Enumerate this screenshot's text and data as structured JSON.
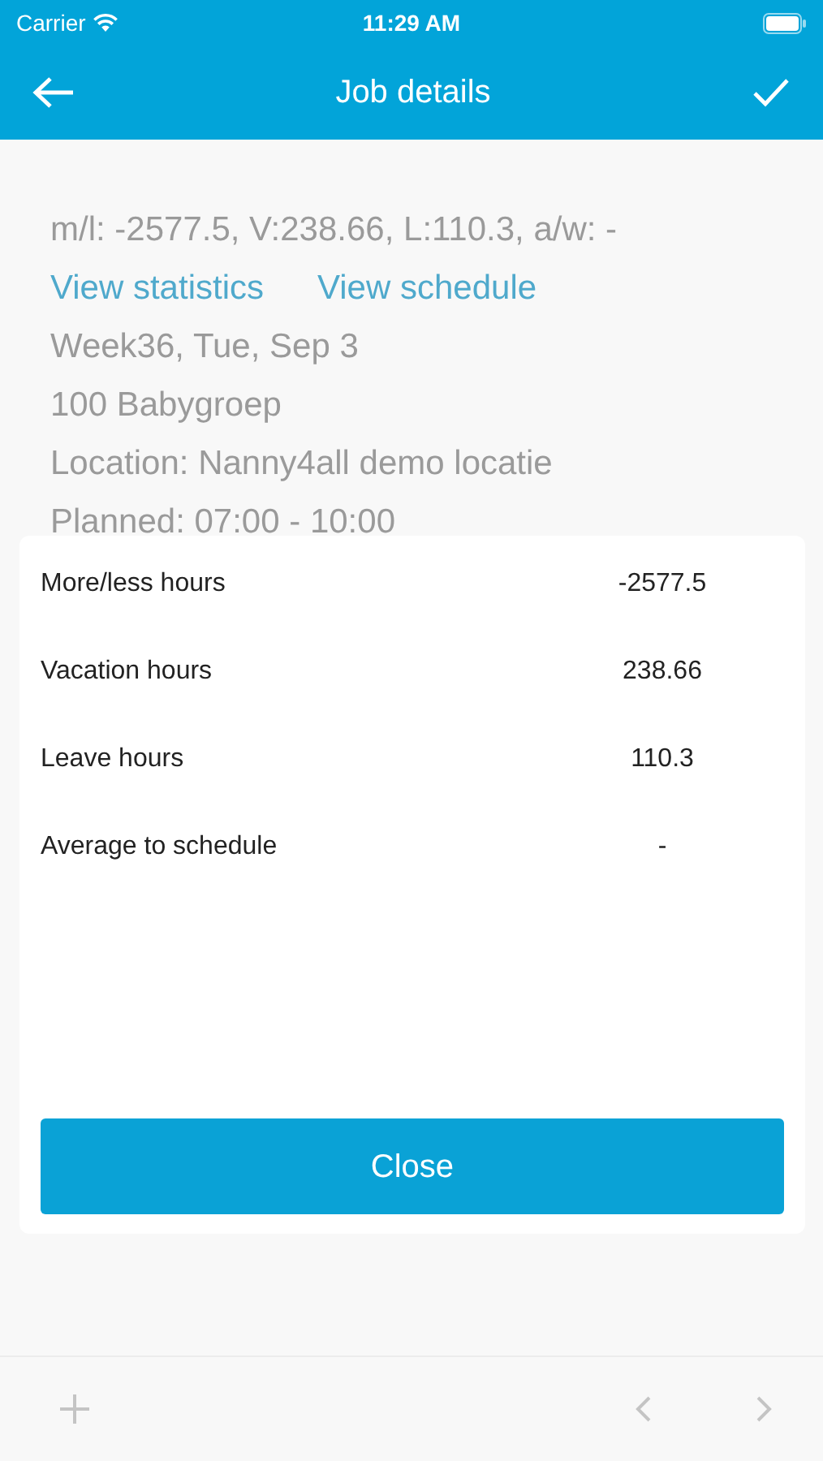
{
  "status_bar": {
    "carrier": "Carrier",
    "time": "11:29 AM"
  },
  "nav": {
    "title": "Job details"
  },
  "details": {
    "summary": "m/l: -2577.5, V:238.66, L:110.3, a/w: -",
    "links": [
      "View statistics",
      "View schedule"
    ],
    "lines": [
      "Week36, Tue, Sep 3",
      "100 Babygroep",
      "Location: Nanny4all demo locatie",
      "Planned: 07:00 - 10:00"
    ]
  },
  "dialog": {
    "rows": [
      {
        "label": "More/less hours",
        "value": "-2577.5"
      },
      {
        "label": "Vacation hours",
        "value": "238.66"
      },
      {
        "label": "Leave hours",
        "value": "110.3"
      },
      {
        "label": "Average to schedule",
        "value": "-"
      }
    ],
    "close_button": "Close"
  }
}
